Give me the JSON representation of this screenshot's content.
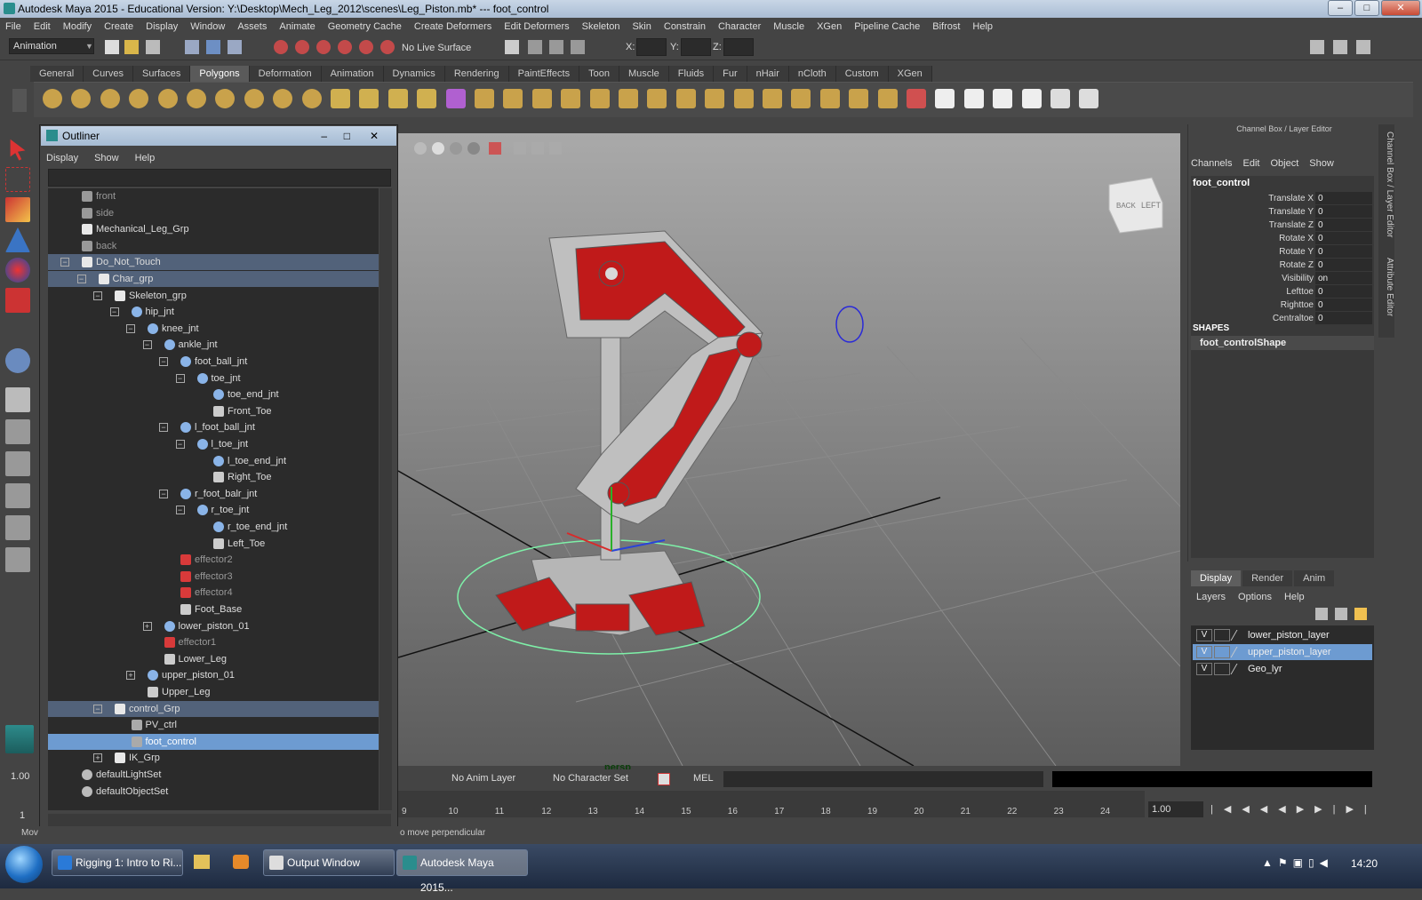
{
  "window": {
    "title": "Autodesk Maya 2015 - Educational Version: Y:\\Desktop\\Mech_Leg_2012\\scenes\\Leg_Piston.mb*  ---  foot_control",
    "minimize": "–",
    "maximize": "□",
    "close": "✕"
  },
  "menubar": [
    "File",
    "Edit",
    "Modify",
    "Create",
    "Display",
    "Window",
    "Assets",
    "Animate",
    "Geometry Cache",
    "Create Deformers",
    "Edit Deformers",
    "Skeleton",
    "Skin",
    "Constrain",
    "Character",
    "Muscle",
    "XGen",
    "Pipeline Cache",
    "Bifrost",
    "Help"
  ],
  "statusline": {
    "mode": "Animation",
    "live_surface": "No Live Surface",
    "x_label": "X:",
    "y_label": "Y:",
    "z_label": "Z:"
  },
  "shelf_tabs": [
    "General",
    "Curves",
    "Surfaces",
    "Polygons",
    "Deformation",
    "Animation",
    "Dynamics",
    "Rendering",
    "PaintEffects",
    "Toon",
    "Muscle",
    "Fluids",
    "Fur",
    "nHair",
    "nCloth",
    "Custom",
    "XGen"
  ],
  "shelf_active": "Polygons",
  "outliner": {
    "title": "Outliner",
    "menu": [
      "Display",
      "Show",
      "Help"
    ],
    "rows": [
      {
        "label": "front",
        "depth": 0,
        "icon": "camera",
        "dim": true
      },
      {
        "label": "side",
        "depth": 0,
        "icon": "camera",
        "dim": true
      },
      {
        "label": "Mechanical_Leg_Grp",
        "depth": 0,
        "icon": "group"
      },
      {
        "label": "back",
        "depth": 0,
        "icon": "camera",
        "dim": true
      },
      {
        "label": "Do_Not_Touch",
        "depth": 0,
        "icon": "group",
        "exp": "−",
        "hl": true
      },
      {
        "label": "Char_grp",
        "depth": 1,
        "icon": "group",
        "exp": "−",
        "hl": true
      },
      {
        "label": "Skeleton_grp",
        "depth": 2,
        "icon": "group",
        "exp": "−"
      },
      {
        "label": "hip_jnt",
        "depth": 3,
        "icon": "joint",
        "exp": "−"
      },
      {
        "label": "knee_jnt",
        "depth": 4,
        "icon": "joint",
        "exp": "−"
      },
      {
        "label": "ankle_jnt",
        "depth": 5,
        "icon": "joint",
        "exp": "−"
      },
      {
        "label": "foot_ball_jnt",
        "depth": 6,
        "icon": "joint",
        "exp": "−"
      },
      {
        "label": "toe_jnt",
        "depth": 7,
        "icon": "joint",
        "exp": "−"
      },
      {
        "label": "toe_end_jnt",
        "depth": 8,
        "icon": "joint"
      },
      {
        "label": "Front_Toe",
        "depth": 8,
        "icon": "mesh"
      },
      {
        "label": "l_foot_ball_jnt",
        "depth": 6,
        "icon": "joint",
        "exp": "−"
      },
      {
        "label": "l_toe_jnt",
        "depth": 7,
        "icon": "joint",
        "exp": "−"
      },
      {
        "label": "l_toe_end_jnt",
        "depth": 8,
        "icon": "joint"
      },
      {
        "label": "Right_Toe",
        "depth": 8,
        "icon": "mesh"
      },
      {
        "label": "r_foot_balr_jnt",
        "depth": 6,
        "icon": "joint",
        "exp": "−"
      },
      {
        "label": "r_toe_jnt",
        "depth": 7,
        "icon": "joint",
        "exp": "−"
      },
      {
        "label": "r_toe_end_jnt",
        "depth": 8,
        "icon": "joint"
      },
      {
        "label": "Left_Toe",
        "depth": 8,
        "icon": "mesh"
      },
      {
        "label": "effector2",
        "depth": 6,
        "icon": "effector",
        "dim": true
      },
      {
        "label": "effector3",
        "depth": 6,
        "icon": "effector",
        "dim": true
      },
      {
        "label": "effector4",
        "depth": 6,
        "icon": "effector",
        "dim": true
      },
      {
        "label": "Foot_Base",
        "depth": 6,
        "icon": "mesh"
      },
      {
        "label": "lower_piston_01",
        "depth": 5,
        "icon": "joint",
        "exp": "+"
      },
      {
        "label": "effector1",
        "depth": 5,
        "icon": "effector",
        "dim": true
      },
      {
        "label": "Lower_Leg",
        "depth": 5,
        "icon": "mesh"
      },
      {
        "label": "upper_piston_01",
        "depth": 4,
        "icon": "joint",
        "exp": "+"
      },
      {
        "label": "Upper_Leg",
        "depth": 4,
        "icon": "mesh"
      },
      {
        "label": "control_Grp",
        "depth": 2,
        "icon": "group",
        "exp": "−",
        "hl": true
      },
      {
        "label": "PV_ctrl",
        "depth": 3,
        "icon": "curve"
      },
      {
        "label": "foot_control",
        "depth": 3,
        "icon": "curve",
        "sel": true
      },
      {
        "label": "IK_Grp",
        "depth": 2,
        "icon": "group",
        "exp": "+"
      },
      {
        "label": "defaultLightSet",
        "depth": 0,
        "icon": "set"
      },
      {
        "label": "defaultObjectSet",
        "depth": 0,
        "icon": "set"
      }
    ]
  },
  "viewport": {
    "camera_label": "persp",
    "cube_back": "BACK",
    "cube_left": "LEFT"
  },
  "channelbox": {
    "header": "Channel Box / Layer Editor",
    "menu": [
      "Channels",
      "Edit",
      "Object",
      "Show"
    ],
    "object": "foot_control",
    "channels": [
      {
        "name": "Translate X",
        "value": "0"
      },
      {
        "name": "Translate Y",
        "value": "0"
      },
      {
        "name": "Translate Z",
        "value": "0"
      },
      {
        "name": "Rotate X",
        "value": "0"
      },
      {
        "name": "Rotate Y",
        "value": "0"
      },
      {
        "name": "Rotate Z",
        "value": "0"
      },
      {
        "name": "Visibility",
        "value": "on"
      },
      {
        "name": "Lefttoe",
        "value": "0"
      },
      {
        "name": "Righttoe",
        "value": "0"
      },
      {
        "name": "Centraltoe",
        "value": "0"
      }
    ],
    "shapes_label": "SHAPES",
    "shape_name": "foot_controlShape",
    "side_tabs": [
      "Channel Box / Layer Editor",
      "Attribute Editor"
    ]
  },
  "layer_editor": {
    "tabs": [
      "Display",
      "Render",
      "Anim"
    ],
    "menu": [
      "Layers",
      "Options",
      "Help"
    ],
    "layers": [
      {
        "v": "V",
        "name": "lower_piston_layer"
      },
      {
        "v": "V",
        "name": "upper_piston_layer",
        "sel": true
      },
      {
        "v": "V",
        "name": "Geo_lyr"
      }
    ]
  },
  "bottom": {
    "left_value": "1.00",
    "frame_one": "1",
    "anim_layer": "No Anim Layer",
    "char_set": "No Character Set",
    "mel": "MEL",
    "frame_value": "1.00",
    "ticks": [
      "9",
      "10",
      "11",
      "12",
      "13",
      "14",
      "15",
      "16",
      "17",
      "18",
      "19",
      "20",
      "21",
      "22",
      "23",
      "24"
    ],
    "help_prefix": "Mov",
    "help_text": "o move perpendicular"
  },
  "taskbar": {
    "items": [
      "Rigging 1: Intro to Ri...",
      "Output Window",
      "Autodesk Maya 2015..."
    ],
    "clock": "14:20"
  }
}
